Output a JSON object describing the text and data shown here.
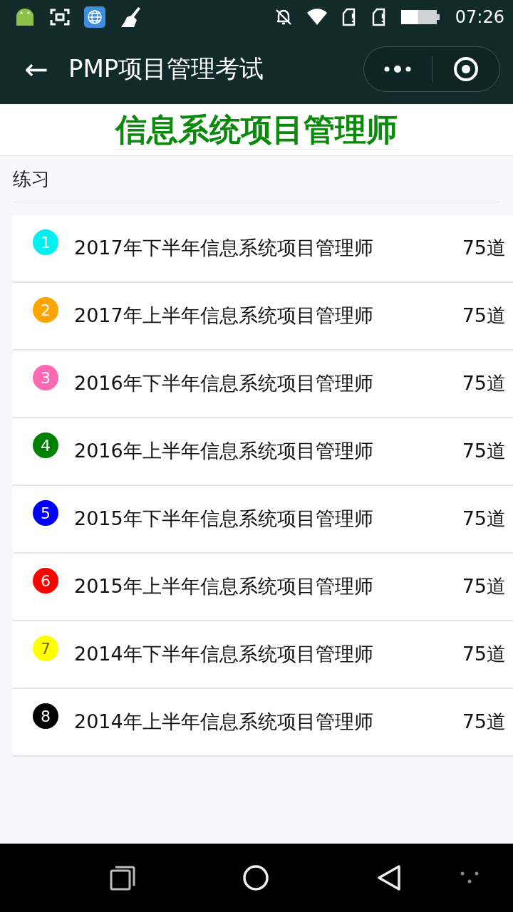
{
  "status_bar": {
    "time": "07:26"
  },
  "nav_bar": {
    "back": "←",
    "title": "PMP项目管理考试"
  },
  "header": {
    "title": "信息系统项目管理师"
  },
  "section": {
    "label": "练习"
  },
  "exams": [
    {
      "number": "1",
      "color": "#00f0f0",
      "title": "2017年下半年信息系统项目管理师",
      "count": "75道"
    },
    {
      "number": "2",
      "color": "#ffa500",
      "title": "2017年上半年信息系统项目管理师",
      "count": "75道"
    },
    {
      "number": "3",
      "color": "#ff69b4",
      "title": "2016年下半年信息系统项目管理师",
      "count": "75道"
    },
    {
      "number": "4",
      "color": "#008000",
      "title": "2016年上半年信息系统项目管理师",
      "count": "75道"
    },
    {
      "number": "5",
      "color": "#0000ff",
      "title": "2015年下半年信息系统项目管理师",
      "count": "75道"
    },
    {
      "number": "6",
      "color": "#ff0000",
      "title": "2015年上半年信息系统项目管理师",
      "count": "75道"
    },
    {
      "number": "7",
      "color": "#ffff00",
      "title": "2014年下半年信息系统项目管理师",
      "count": "75道"
    },
    {
      "number": "8",
      "color": "#000000",
      "title": "2014年上半年信息系统项目管理师",
      "count": "75道"
    }
  ]
}
